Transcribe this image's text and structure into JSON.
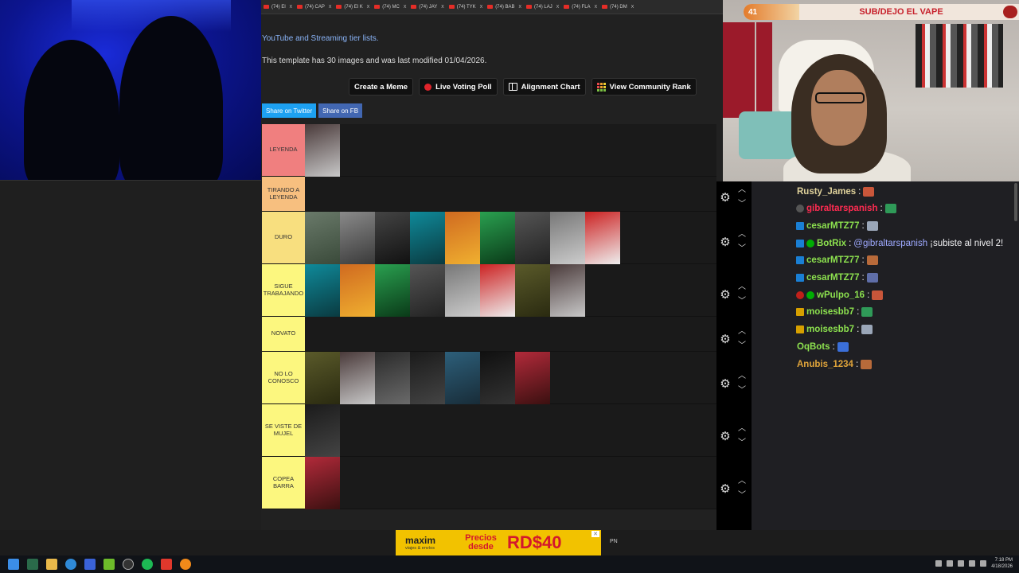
{
  "browser": {
    "tabs": [
      "(74) El",
      "(74) CAP",
      "(74) El K",
      "(74) MC",
      "(74) JAY",
      "(74) TYK",
      "(74) BAB",
      "(74) LAJ",
      "(74) FLA",
      "(74) DM"
    ],
    "tab_close": "x",
    "page_link": "YouTube and Streaming tier lists.",
    "page_info": "This template has 30 images and was last modified 01/04/2026.",
    "buttons": {
      "create_meme": "Create a Meme",
      "live_poll": "Live Voting Poll",
      "alignment": "Alignment Chart",
      "community": "View Community Rank"
    },
    "share": {
      "twitter": "Share on Twitter",
      "facebook": "Share on FB"
    }
  },
  "tiers": [
    {
      "label": "LEYENDA",
      "color": "#f07f7f",
      "count": 1
    },
    {
      "label": "TIRANDO A LEYENDA",
      "color": "#f7bf7f",
      "count": 0
    },
    {
      "label": "DURO",
      "color": "#f8df7f",
      "count": 9
    },
    {
      "label": "SIGUE TRABAJANDO",
      "color": "#fcf77f",
      "count": 8
    },
    {
      "label": "NOVATO",
      "color": "#fcf77f",
      "count": 0
    },
    {
      "label": "NO LO CONOSCO",
      "color": "#fcf77f",
      "count": 7
    },
    {
      "label": "SE VISTE DE MUJEL",
      "color": "#fcf77f",
      "count": 1
    },
    {
      "label": "COPEA BARRA",
      "color": "#fcf77f",
      "count": 1
    }
  ],
  "stream_overlay": {
    "count": "41",
    "goal_text": "SUB/DEJO EL VAPE"
  },
  "chat": [
    {
      "user": "Rusty_James",
      "color": "#e0d29b",
      "badges": [],
      "text": ""
    },
    {
      "user": "gibraltarspanish",
      "color": "#ff2b51",
      "badges": [
        "gray"
      ],
      "text": ""
    },
    {
      "user": "cesarMTZ77",
      "color": "#8de24f",
      "badges": [
        "mod"
      ],
      "text": ""
    },
    {
      "user": "BotRix",
      "color": "#8de24f",
      "badges": [
        "mod",
        "green"
      ],
      "mention": "@gibraltarspanish",
      "text": "¡subiste al nivel 2!"
    },
    {
      "user": "cesarMTZ77",
      "color": "#8de24f",
      "badges": [
        "mod"
      ],
      "text": ""
    },
    {
      "user": "cesarMTZ77",
      "color": "#8de24f",
      "badges": [
        "mod"
      ],
      "text": ""
    },
    {
      "user": "wPulpo_16",
      "color": "#8de24f",
      "badges": [
        "red",
        "green"
      ],
      "text": ""
    },
    {
      "user": "moisesbb7",
      "color": "#8de24f",
      "badges": [
        "crown"
      ],
      "text": ""
    },
    {
      "user": "moisesbb7",
      "color": "#8de24f",
      "badges": [
        "crown"
      ],
      "text": ""
    },
    {
      "user": "OqBots",
      "color": "#8de24f",
      "badges": [],
      "text": ""
    },
    {
      "user": "Anubis_1234",
      "color": "#e0a43a",
      "badges": [],
      "text": ""
    }
  ],
  "chat_separator": ":",
  "ad": {
    "brand": "maxim",
    "tagline": "viajes & envíos",
    "label": "Precios desde",
    "price": "RD$40",
    "close": "✕"
  },
  "ad_tag": "PN",
  "taskbar": {
    "time": "7:18 PM",
    "date": "4/18/2026"
  }
}
